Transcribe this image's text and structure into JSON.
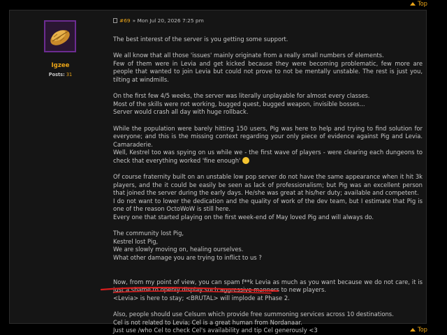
{
  "top_link": {
    "label": "Top"
  },
  "user": {
    "name": "Igzee",
    "posts_label": "Posts:",
    "posts_count": "31"
  },
  "post": {
    "id": "#69",
    "date": "» Mon Jul 20, 2026 7:25 pm",
    "lines": [
      "The best interest of the server is you getting some support.",
      "",
      "We all know that all those 'issues' mainly originate from a really small numbers of elements.",
      "Few of them were in Levia and get kicked because they were becoming problematic, few more are people that wanted to join Levia but could not prove to not be mentally unstable. The rest is just you, tilting at windmills.",
      "",
      "On the first few 4/5 weeks, the server was literally unplayable for almost every classes.",
      "Most of the skills were not working, bugged quest, bugged weapon, invisible bosses...",
      "Server would crash all day with huge rollback.",
      "",
      "While the population were barely hitting 150 users, Pig was here to help and trying to find solution for everyone; and this is the missing context regarding your only piece of evidence against Pig and Levia. Camaraderie.",
      "Well, Kestrel too was spying on us while we - the first wave of players - were clearing each dungeons to check that everything worked 'fine enough'",
      "",
      "Of course fraternity built on an unstable low pop server do not have the same appearance when it hit 3k players, and the it could be easily be seen as lack of professionalism; but Pig was an excellent person that joined the server during the early days. He/she was great at his/her duty; available and competent.",
      "I do not want to lower the dedication and the quality of work of the dev team, but I estimate that Pig is one of the reason OctoWoW is still here.",
      "Every one that started playing on the first week-end of May loved Pig and will always do.",
      "",
      "The community lost Pig,",
      "Kestrel lost Pig,",
      "We are slowly moving on, healing ourselves.",
      "What other damage you are trying to inflict to us ?",
      "",
      "",
      "Now, from my point of view, you can spam f**k Levia as much as you want because we do not care, it is just a shame to openly display such aggressive manners to new players.",
      "<Levia> is here to stay; <BRUTAL> will implode at Phase 2.",
      "",
      "Also, people should use Celsum which provide free summoning services across 10 destinations.",
      "Cel is not related to Levia; Cel is a great human from Nordanaar.",
      "Just use /who Cel to check Cel's availability and tip Cel generously <3"
    ]
  },
  "colors": {
    "accent": "#e8a317",
    "panel": "#151515",
    "annotation": "#d81f1f"
  },
  "icons": {
    "avatar": "bread-icon",
    "post": "document-icon",
    "top": "triangle-up-icon",
    "emoji": "smile-emoji"
  }
}
